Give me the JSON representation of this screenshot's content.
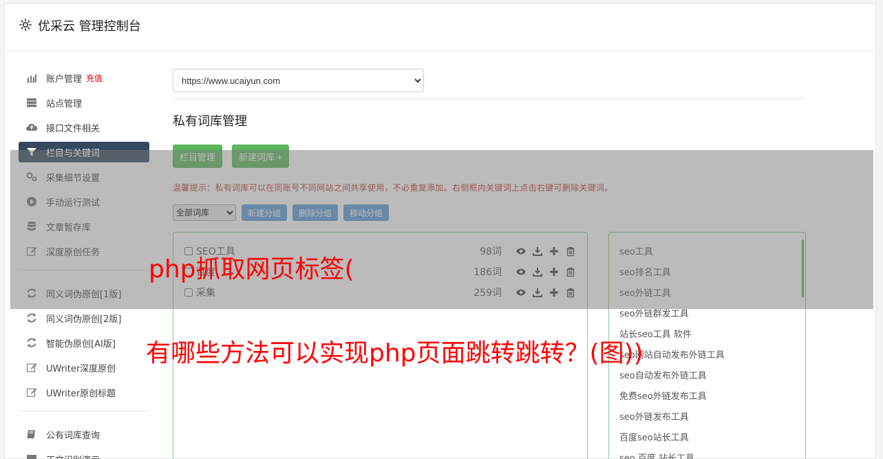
{
  "header": {
    "title": "优采云 管理控制台",
    "icon": "gear-icon"
  },
  "sidebar": {
    "group1": [
      {
        "label": "账户管理",
        "badge": "充值",
        "icon": "bar-chart-icon"
      },
      {
        "label": "站点管理",
        "icon": "server-icon"
      },
      {
        "label": "接口文件相关",
        "icon": "cloud-upload-icon"
      },
      {
        "label": "栏目与关键词",
        "icon": "filter-icon",
        "active": true
      },
      {
        "label": "采集细节设置",
        "icon": "gears-icon"
      },
      {
        "label": "手动运行测试",
        "icon": "play-icon"
      },
      {
        "label": "文章暂存库",
        "icon": "database-icon"
      },
      {
        "label": "深度原创任务",
        "icon": "edit-icon"
      }
    ],
    "group2": [
      {
        "label": "同义词伪原创[1版]",
        "icon": "refresh-icon"
      },
      {
        "label": "同义词伪原创[2版]",
        "icon": "refresh-icon"
      },
      {
        "label": "智能伪原创[AI版]",
        "icon": "refresh-icon"
      },
      {
        "label": "UWriter深度原创",
        "icon": "edit-icon"
      },
      {
        "label": "UWriter原创标题",
        "icon": "edit-icon"
      }
    ],
    "group3": [
      {
        "label": "公有词库查询",
        "icon": "book-icon"
      },
      {
        "label": "正文识别演示",
        "icon": "monitor-icon"
      }
    ]
  },
  "main": {
    "site_select": "https://www.ucaiyun.com",
    "section_title": "私有词库管理",
    "btn_column": "栏目管理",
    "btn_new_lib": "新建词库 +",
    "tip": "温馨提示：私有词库可以在同账号不同网站之间共享使用，不必重复添加。右侧框内关键词上点击右键可删除关键词。",
    "group_select": "全部词库",
    "btn_new_group": "新建分组",
    "btn_delete_group": "删除分组",
    "btn_move_group": "移动分组",
    "libraries": [
      {
        "name": "SEO工具",
        "count": "98词"
      },
      {
        "name": "百度",
        "count": "186词"
      },
      {
        "name": "采集",
        "count": "259词"
      }
    ],
    "keywords": [
      "seo工具",
      "seo排名工具",
      "seo外链工具",
      "seo外链群发工具",
      "站长seo工具 软件",
      "seo网站自动发布外链工具",
      "seo自动发布外链工具",
      "免费seo外链发布工具",
      "seo外链发布工具",
      "百度seo站长工具",
      "seo 百度 站长工具"
    ]
  },
  "overlay": {
    "headline1": "php抓取网页标签(",
    "headline2": "有哪些方法可以实现php页面跳转跳转？(图))"
  },
  "colors": {
    "active_nav": "#34495e",
    "green": "#5cb85c",
    "blue": "#5b9bd5",
    "headline": "#ff0000"
  }
}
